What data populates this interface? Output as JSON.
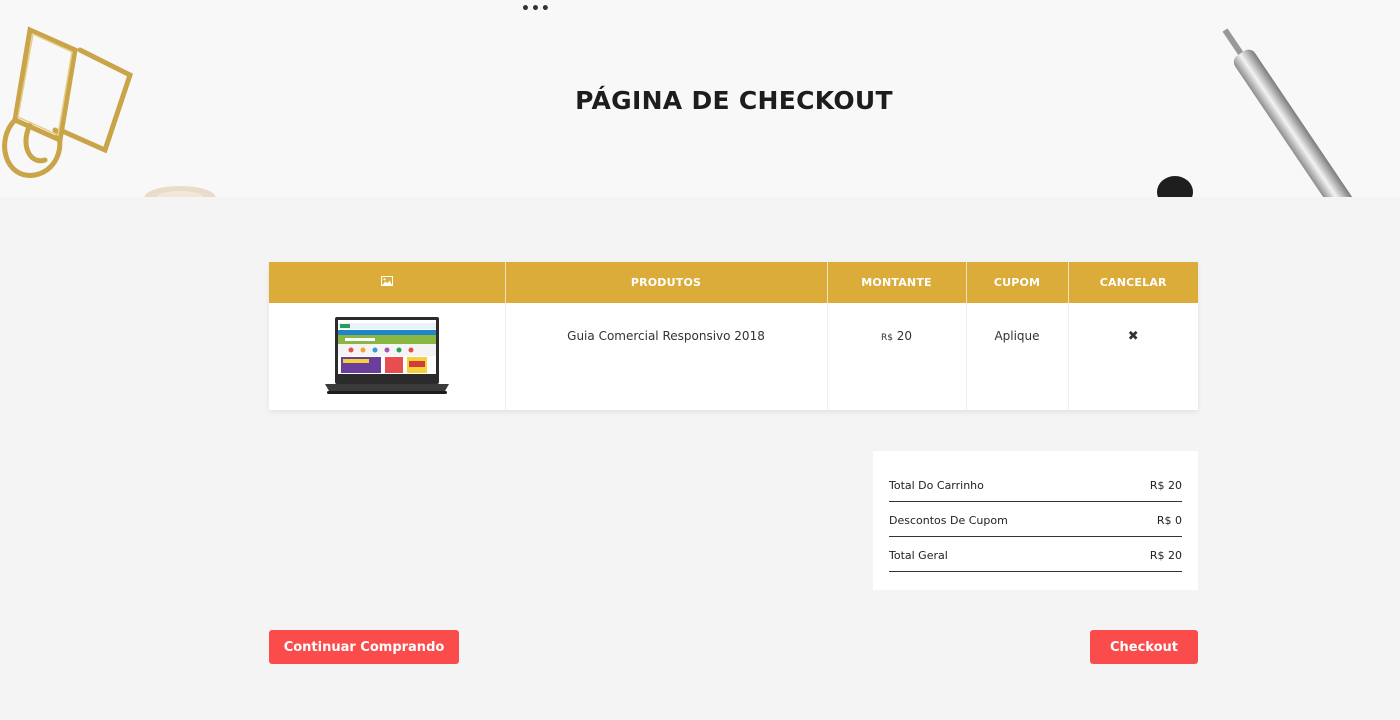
{
  "hero": {
    "title": "PÁGINA DE CHECKOUT",
    "menu_dots": "•••"
  },
  "table": {
    "headers": {
      "image_icon": "image-icon",
      "products": "PRODUTOS",
      "amount": "MONTANTE",
      "coupon": "CUPOM",
      "cancel": "CANCELAR"
    },
    "rows": [
      {
        "product_name": "Guia Comercial Responsivo 2018",
        "currency": "R$",
        "amount": "20",
        "coupon_action": "Aplique",
        "remove_glyph": "✖"
      }
    ]
  },
  "totals": {
    "cart_total_label": "Total Do Carrinho",
    "cart_total_value": "R$ 20",
    "coupon_discount_label": "Descontos De Cupom",
    "coupon_discount_value": "R$ 0",
    "grand_total_label": "Total Geral",
    "grand_total_value": "R$ 20"
  },
  "actions": {
    "continue_label": "Continuar Comprando",
    "checkout_label": "Checkout"
  },
  "colors": {
    "header_gold": "#dcac3a",
    "button_red": "#fb4c4c",
    "background": "#f4f4f4"
  }
}
